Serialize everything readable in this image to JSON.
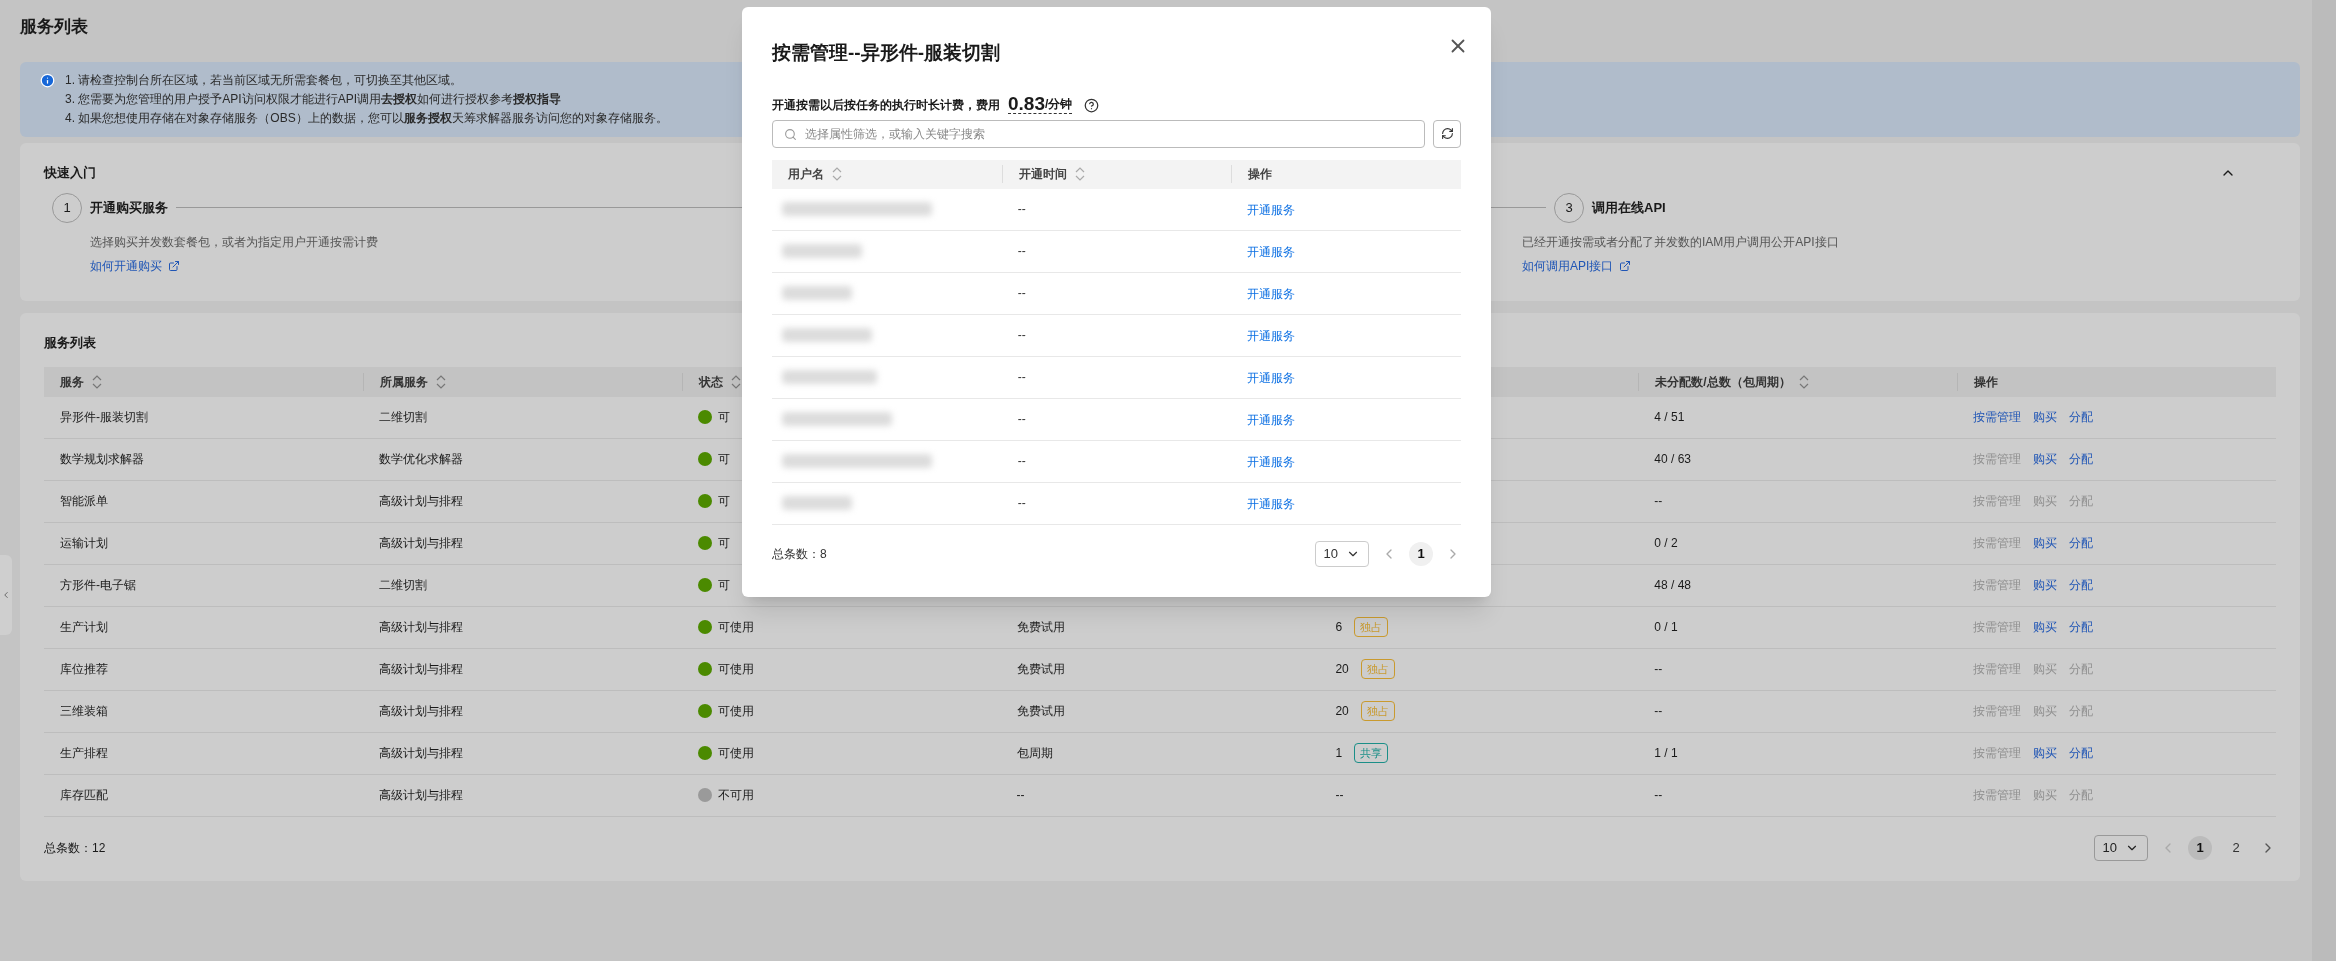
{
  "page_title": "服务列表",
  "notice": {
    "lines": [
      "1. 请检查控制台所在区域，若当前区域无所需套餐包，可切换至其他区域。",
      "3. 您需要为您管理的用户授予API访问权限才能进行API调用**去授权**如何进行授权参考**授权指导**",
      "4. 如果您想使用存储在对象存储服务（OBS）上的数据，您可以**服务授权**天筹求解器服务访问您的对象存储服务。"
    ]
  },
  "quick_start": {
    "title": "快速入门",
    "expanded": true,
    "steps": [
      {
        "number": "1",
        "title": "开通购买服务",
        "description": "选择购买并发数套餐包，或者为指定用户开通按需计费",
        "link": "如何开通购买"
      },
      {
        "number": "3",
        "title": "调用在线API",
        "description": "已经开通按需或者分配了并发数的IAM用户调用公开API接口",
        "link": "如何调用API接口"
      }
    ]
  },
  "services": {
    "title": "服务列表",
    "columns": [
      {
        "label": "服务",
        "sortable": true
      },
      {
        "label": "所属服务",
        "sortable": true
      },
      {
        "label": "状态",
        "sortable": true
      },
      {
        "label": "未分配数/总数（包周期）",
        "sortable": true
      },
      {
        "label": "操作",
        "sortable": false
      }
    ],
    "rows": [
      {
        "service": "异形件-服装切割",
        "parent": "二维切割",
        "status": "可",
        "available": true,
        "unassigned": "4 / 51",
        "actions": [
          {
            "label": "按需管理",
            "enabled": true
          },
          {
            "label": "购买",
            "enabled": true
          },
          {
            "label": "分配",
            "enabled": true
          }
        ]
      },
      {
        "service": "数学规划求解器",
        "parent": "数学优化求解器",
        "status": "可",
        "available": true,
        "unassigned": "40 / 63",
        "actions": [
          {
            "label": "按需管理",
            "enabled": false
          },
          {
            "label": "购买",
            "enabled": true
          },
          {
            "label": "分配",
            "enabled": true
          }
        ]
      },
      {
        "service": "智能派单",
        "parent": "高级计划与排程",
        "status": "可",
        "available": true,
        "unassigned": "--",
        "actions": [
          {
            "label": "按需管理",
            "enabled": false
          },
          {
            "label": "购买",
            "enabled": false
          },
          {
            "label": "分配",
            "enabled": false
          }
        ]
      },
      {
        "service": "运输计划",
        "parent": "高级计划与排程",
        "status": "可",
        "available": true,
        "unassigned": "0 / 2",
        "actions": [
          {
            "label": "按需管理",
            "enabled": false
          },
          {
            "label": "购买",
            "enabled": true
          },
          {
            "label": "分配",
            "enabled": true
          }
        ]
      },
      {
        "service": "方形件-电子锯",
        "parent": "二维切割",
        "status": "可",
        "available": true,
        "unassigned": "48 / 48",
        "actions": [
          {
            "label": "按需管理",
            "enabled": false
          },
          {
            "label": "购买",
            "enabled": true
          },
          {
            "label": "分配",
            "enabled": true
          }
        ]
      },
      {
        "service": "生产计划",
        "parent": "高级计划与排程",
        "status": "可使用",
        "available": true,
        "billing": "免费试用",
        "count": "6",
        "tag": {
          "text": "独占",
          "kind": "exclusive"
        },
        "unassigned": "0 / 1",
        "actions": [
          {
            "label": "按需管理",
            "enabled": false
          },
          {
            "label": "购买",
            "enabled": true
          },
          {
            "label": "分配",
            "enabled": true
          }
        ]
      },
      {
        "service": "库位推荐",
        "parent": "高级计划与排程",
        "status": "可使用",
        "available": true,
        "billing": "免费试用",
        "count": "20",
        "tag": {
          "text": "独占",
          "kind": "exclusive"
        },
        "unassigned": "--",
        "actions": [
          {
            "label": "按需管理",
            "enabled": false
          },
          {
            "label": "购买",
            "enabled": false
          },
          {
            "label": "分配",
            "enabled": false
          }
        ]
      },
      {
        "service": "三维装箱",
        "parent": "高级计划与排程",
        "status": "可使用",
        "available": true,
        "billing": "免费试用",
        "count": "20",
        "tag": {
          "text": "独占",
          "kind": "exclusive"
        },
        "unassigned": "--",
        "actions": [
          {
            "label": "按需管理",
            "enabled": false
          },
          {
            "label": "购买",
            "enabled": false
          },
          {
            "label": "分配",
            "enabled": false
          }
        ]
      },
      {
        "service": "生产排程",
        "parent": "高级计划与排程",
        "status": "可使用",
        "available": true,
        "billing": "包周期",
        "count": "1",
        "tag": {
          "text": "共享",
          "kind": "shared"
        },
        "unassigned": "1 / 1",
        "actions": [
          {
            "label": "按需管理",
            "enabled": false
          },
          {
            "label": "购买",
            "enabled": true
          },
          {
            "label": "分配",
            "enabled": true
          }
        ]
      },
      {
        "service": "库存匹配",
        "parent": "高级计划与排程",
        "status": "不可用",
        "available": false,
        "billing": "--",
        "count": "--",
        "unassigned": "--",
        "actions": [
          {
            "label": "按需管理",
            "enabled": false
          },
          {
            "label": "购买",
            "enabled": false
          },
          {
            "label": "分配",
            "enabled": false
          }
        ]
      }
    ],
    "total": "总条数：12",
    "page_size": "10",
    "pages": [
      {
        "label": "1",
        "selected": true
      },
      {
        "label": "2",
        "selected": false
      }
    ]
  },
  "dialog": {
    "title": "按需管理--异形件-服装切割",
    "fee": {
      "prefix": "开通按需以后按任务的执行时长计费，费用",
      "amount": "0.83",
      "unit": "/分钟"
    },
    "search_placeholder": "选择属性筛选，或输入关键字搜索",
    "columns": [
      {
        "label": "用户名",
        "sortable": true
      },
      {
        "label": "开通时间",
        "sortable": true
      },
      {
        "label": "操作",
        "sortable": false
      }
    ],
    "rows": [
      {
        "open_time": "--",
        "action": "开通服务"
      },
      {
        "open_time": "--",
        "action": "开通服务"
      },
      {
        "open_time": "--",
        "action": "开通服务"
      },
      {
        "open_time": "--",
        "action": "开通服务"
      },
      {
        "open_time": "--",
        "action": "开通服务"
      },
      {
        "open_time": "--",
        "action": "开通服务"
      },
      {
        "open_time": "--",
        "action": "开通服务"
      },
      {
        "open_time": "--",
        "action": "开通服务"
      }
    ],
    "total": "总条数：8",
    "page_size": "10",
    "pages": [
      {
        "label": "1",
        "selected": true
      }
    ]
  }
}
